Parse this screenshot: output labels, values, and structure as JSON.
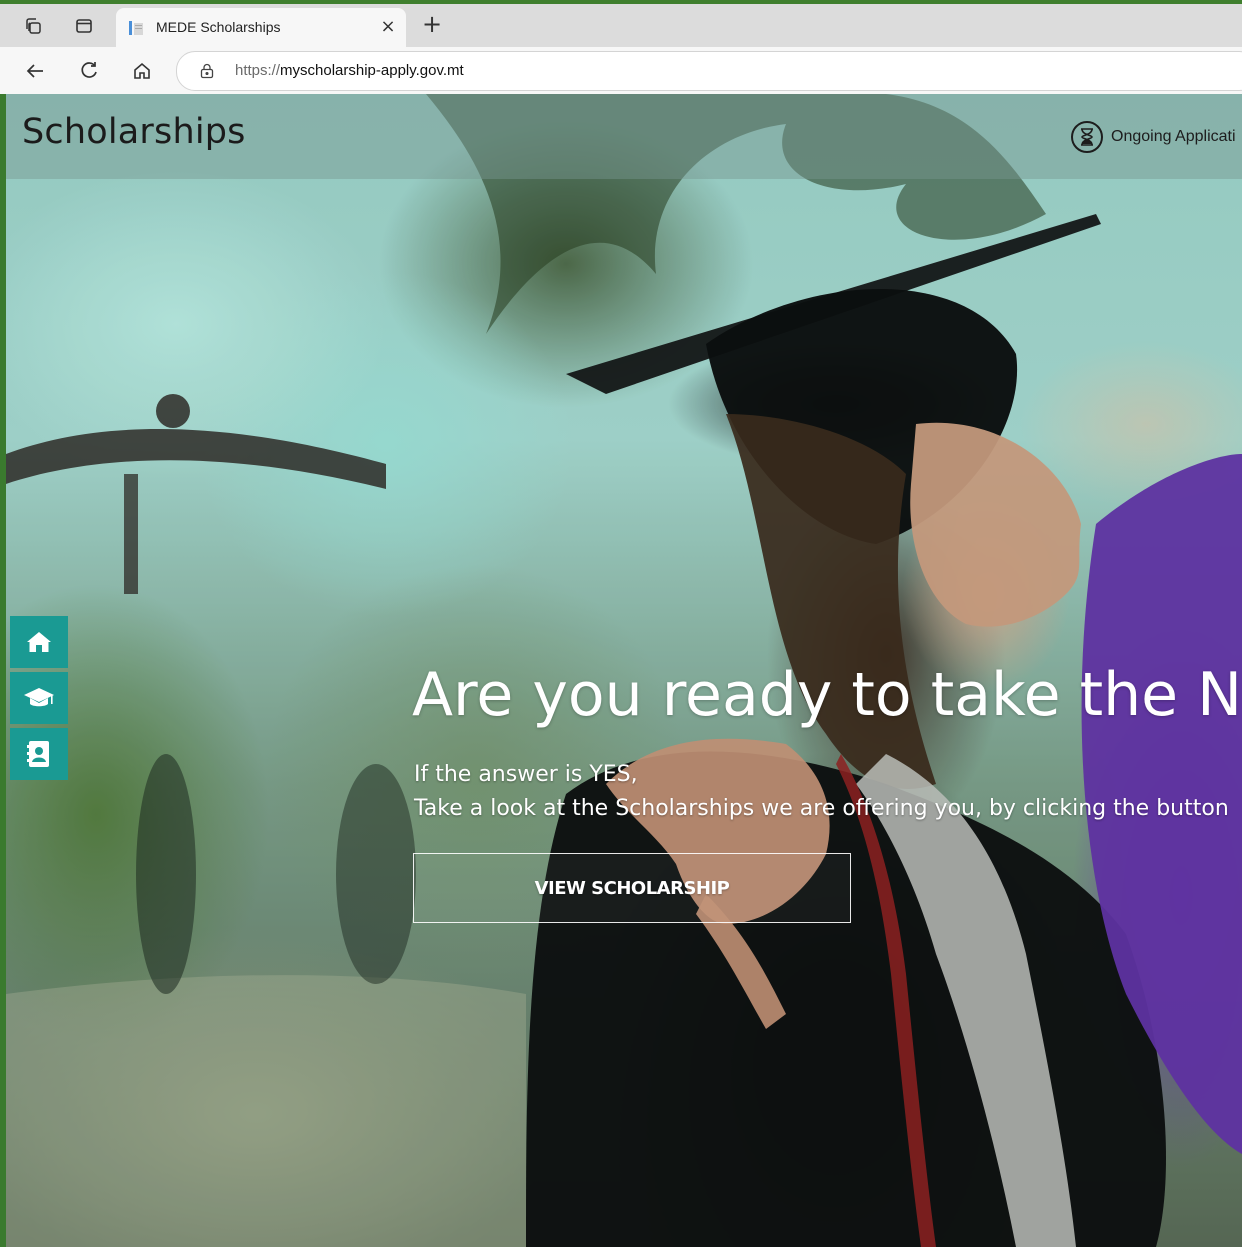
{
  "browser": {
    "tab_title": "MEDE Scholarships",
    "tab_close": "×",
    "new_tab": "+",
    "url_scheme": "https://",
    "url_host": "myscholarship-apply.gov.mt"
  },
  "site": {
    "title": "Scholarships",
    "ongoing_label": "Ongoing Applicati"
  },
  "side_nav": {
    "items": [
      {
        "icon": "home-icon"
      },
      {
        "icon": "graduation-cap-icon"
      },
      {
        "icon": "contact-card-icon"
      }
    ]
  },
  "hero": {
    "heading": "Are you ready to take the N",
    "line1": "If the answer is YES,",
    "line2": "Take a look at the Scholarships we are offering you, by clicking the button",
    "cta_label": "VIEW SCHOLARSHIP"
  },
  "colors": {
    "accent": "#1a9a93",
    "window_border": "#3f7f2e"
  }
}
